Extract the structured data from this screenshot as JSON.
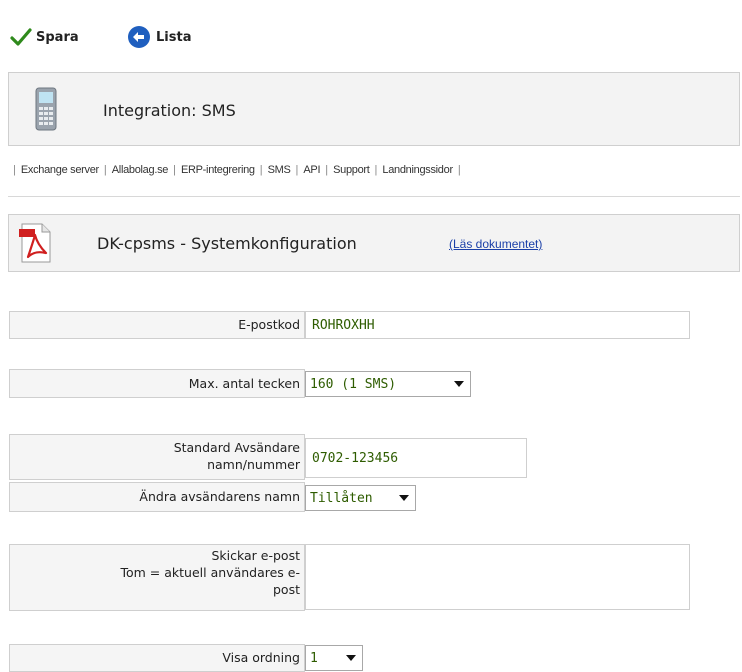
{
  "toolbar": {
    "save_label": "Spara",
    "list_label": "Lista"
  },
  "integration_header": {
    "title": "Integration: SMS"
  },
  "nav_links": [
    "Exchange server",
    "Allabolag.se",
    "ERP-integrering",
    "SMS",
    "API",
    "Support",
    "Landningssidor"
  ],
  "document_header": {
    "title": "DK-cpsms - Systemkonfiguration",
    "link_text": "(Läs dokumentet)"
  },
  "form": {
    "email_code": {
      "label": "E-postkod",
      "value": "ROHROXHH"
    },
    "max_chars": {
      "label": "Max. antal tecken",
      "selected": "160 (1 SMS)"
    },
    "sender": {
      "label_line1": "Standard Avsändare",
      "label_line2": "namn/nummer",
      "value": "0702-123456"
    },
    "change_sender": {
      "label": "Ändra avsändarens namn",
      "selected": "Tillåten"
    },
    "send_email": {
      "label_line1": "Skickar e-post",
      "label_line2": "Tom = aktuell användares e-",
      "label_line3": "post",
      "value": ""
    },
    "display_order": {
      "label": "Visa ordning",
      "selected": "1"
    }
  },
  "colors": {
    "value_text": "#2e5c00",
    "panel_bg": "#f3f3f3",
    "link": "#1a3fa8",
    "check_icon": "#2f8a1c",
    "list_icon": "#1f5fbf"
  }
}
